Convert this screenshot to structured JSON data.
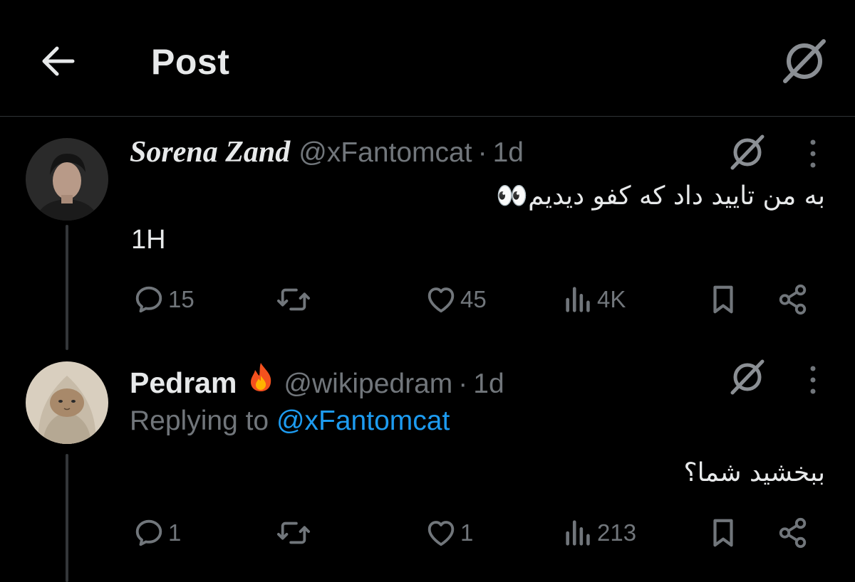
{
  "header": {
    "title": "Post",
    "back_icon": "back-arrow-icon",
    "grok_icon": "grok-icon"
  },
  "tweets": [
    {
      "name": "Sorena Zand",
      "handle": "@xFantomcat",
      "separator": "·",
      "time": "1d",
      "text_rtl": "به من تایید داد که کفو دیدیم👀",
      "text": "1H",
      "replies": "15",
      "likes": "45",
      "views": "4K"
    },
    {
      "name": "Pedram",
      "handle": "@wikipedram",
      "separator": "·",
      "time": "1d",
      "replying_prefix": "Replying to ",
      "replying_to": "@xFantomcat",
      "text_rtl": "ببخشید شما؟",
      "replies": "1",
      "likes": "1",
      "views": "213"
    }
  ],
  "colors": {
    "background": "#000000",
    "text": "#e7e9ea",
    "secondary": "#71767b",
    "link": "#1d9bf0",
    "divider": "#2f3336"
  }
}
